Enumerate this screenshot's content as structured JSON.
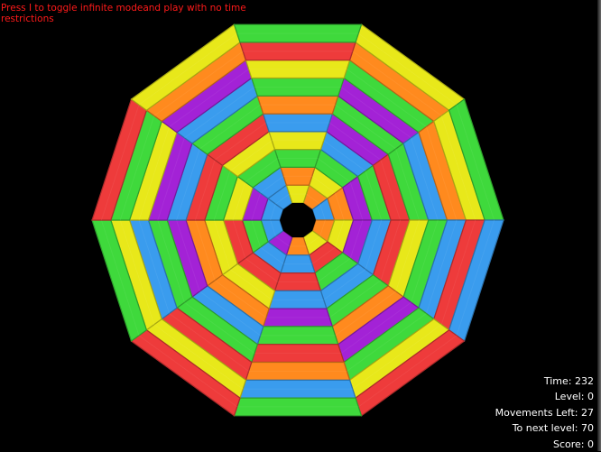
{
  "hint": "Press I to toggle infinite modeand play with no time restrictions",
  "stats": [
    {
      "label": "Time:",
      "value": "232"
    },
    {
      "label": "Level:",
      "value": "0"
    },
    {
      "label": "Movements Left:",
      "value": "27"
    },
    {
      "label": "To next level:",
      "value": "70"
    },
    {
      "label": "Score:",
      "value": "0"
    }
  ],
  "board": {
    "sides": 10,
    "rings": 10,
    "palette": {
      "R": "#ee3b3b",
      "O": "#ff8a1e",
      "Y": "#e8e81a",
      "G": "#3fd93c",
      "B": "#3a9cee",
      "P": "#a322d6"
    },
    "sectors": [
      [
        "O",
        "Y",
        "G",
        "B",
        "P",
        "G",
        "P",
        "G",
        "O",
        "Y"
      ],
      [
        "B",
        "O",
        "P",
        "G",
        "R",
        "G",
        "B",
        "O",
        "Y",
        "G"
      ],
      [
        "O",
        "Y",
        "P",
        "B",
        "R",
        "Y",
        "G",
        "B",
        "R",
        "B"
      ],
      [
        "Y",
        "R",
        "G",
        "B",
        "G",
        "O",
        "P",
        "G",
        "Y",
        "R"
      ],
      [
        "O",
        "B",
        "R",
        "B",
        "P",
        "G",
        "R",
        "O",
        "B",
        "G"
      ],
      [
        "P",
        "B",
        "R",
        "Y",
        "O",
        "B",
        "G",
        "R",
        "Y",
        "R"
      ],
      [
        "B",
        "G",
        "R",
        "Y",
        "O",
        "P",
        "G",
        "B",
        "Y",
        "G"
      ],
      [
        "B",
        "P",
        "Y",
        "G",
        "R",
        "B",
        "P",
        "Y",
        "G",
        "R"
      ],
      [
        "B",
        "B",
        "G",
        "Y",
        "R",
        "G",
        "B",
        "P",
        "O",
        "Y"
      ],
      [
        "Y",
        "O",
        "G",
        "Y",
        "B",
        "O",
        "G",
        "Y",
        "R",
        "G"
      ]
    ]
  }
}
